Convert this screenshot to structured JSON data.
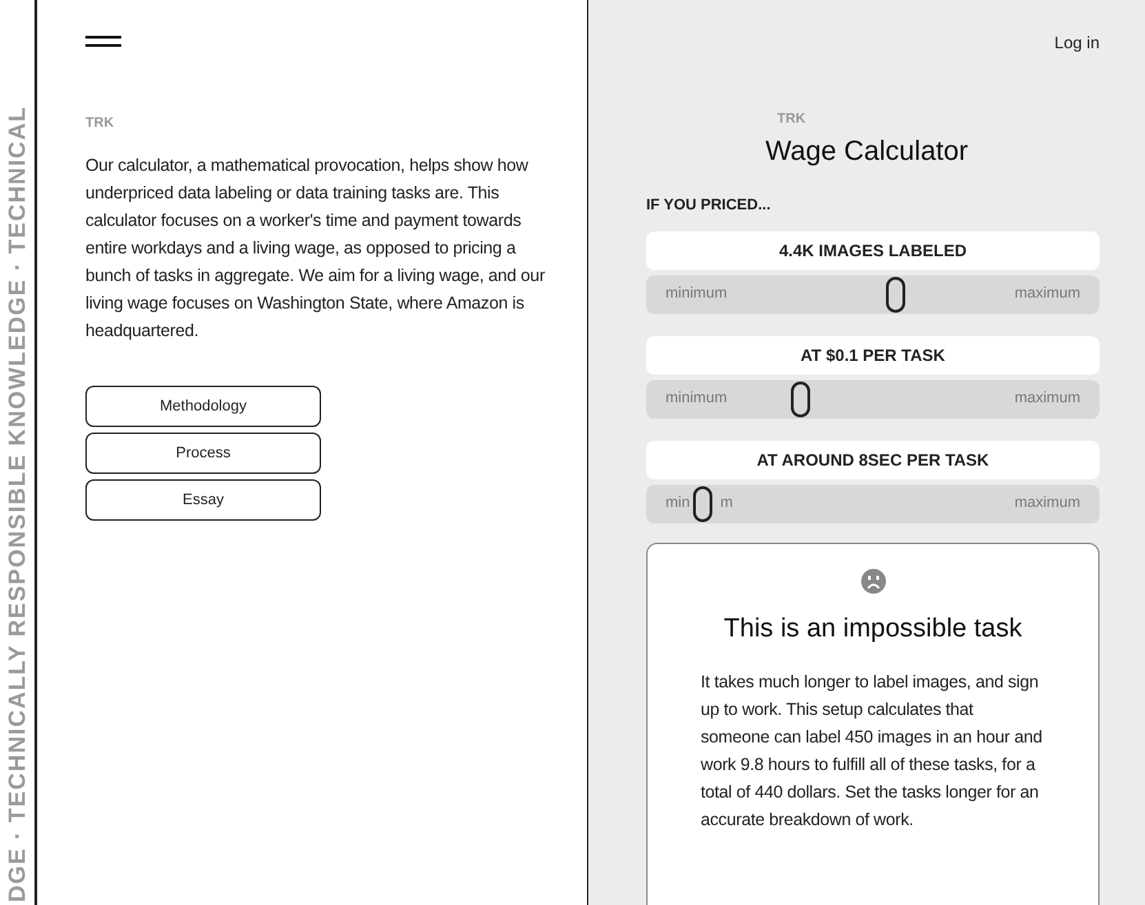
{
  "side_banner": "DGE · TECHNICALLY RESPONSIBLE KNOWLEDGE · TECHNICAL",
  "left": {
    "logo": "TRK",
    "intro": "Our calculator, a mathematical provocation, helps show how underpriced data labeling or data training tasks are. This calculator focuses on a worker's time and payment towards entire workdays and a living wage, as opposed to pricing a bunch of tasks in aggregate. We aim for a living wage, and our living wage focuses on Washington State, where Amazon is headquartered.",
    "links": [
      "Methodology",
      "Process",
      "Essay"
    ]
  },
  "right": {
    "login": "Log in",
    "logo": "TRK",
    "title": "Wage Calculator",
    "section_label": "IF YOU PRICED...",
    "sliders": [
      {
        "label": "4.4K IMAGES LABELED",
        "min_label_parts": [
          "minimum"
        ],
        "max_label": "maximum",
        "level": 0.55
      },
      {
        "label": "AT $0.1 PER TASK",
        "min_label_parts": [
          "minimum"
        ],
        "max_label": "maximum",
        "level": 0.34
      },
      {
        "label": "AT AROUND 8SEC PER TASK",
        "min_label_parts": [
          "min",
          "m"
        ],
        "max_label": "maximum",
        "level": 0.125
      }
    ],
    "result": {
      "title": "This is an impossible task",
      "text": "It takes much longer to label images, and sign up to work. This setup calculates that someone can label 450 images in an hour and work 9.8 hours to fulfill all of these tasks, for a total of 440 dollars. Set the tasks longer for an accurate breakdown of work."
    }
  }
}
